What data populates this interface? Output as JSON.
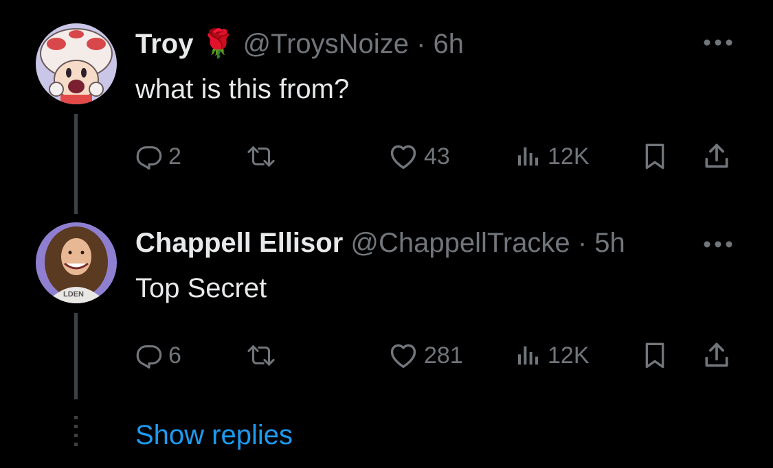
{
  "replies": [
    {
      "name": "Troy",
      "emoji": "🌹",
      "handle": "@TroysNoize",
      "separator": "·",
      "time": "6h",
      "text": "what is this from?",
      "stats": {
        "replies": "2",
        "likes": "43",
        "views": "12K"
      },
      "avatar_colors": {
        "bg": "#c9c6e8",
        "cap": "#f3ece9",
        "spot": "#d8474a"
      }
    },
    {
      "name": "Chappell Ellisor",
      "handle": "@ChappellTracke",
      "separator": "·",
      "time": "5h",
      "text": "Top Secret",
      "stats": {
        "replies": "6",
        "likes": "281",
        "views": "12K"
      },
      "avatar_colors": {
        "bg": "#8f7fd0",
        "hair": "#5b3a22",
        "shirt": "#e9e7e4"
      }
    }
  ],
  "more_label": "•••",
  "show_replies": "Show replies",
  "colors": {
    "background": "#000000",
    "text": "#e7e9ea",
    "muted": "#71767b",
    "link": "#1d9bf0",
    "line": "#3e4144"
  }
}
